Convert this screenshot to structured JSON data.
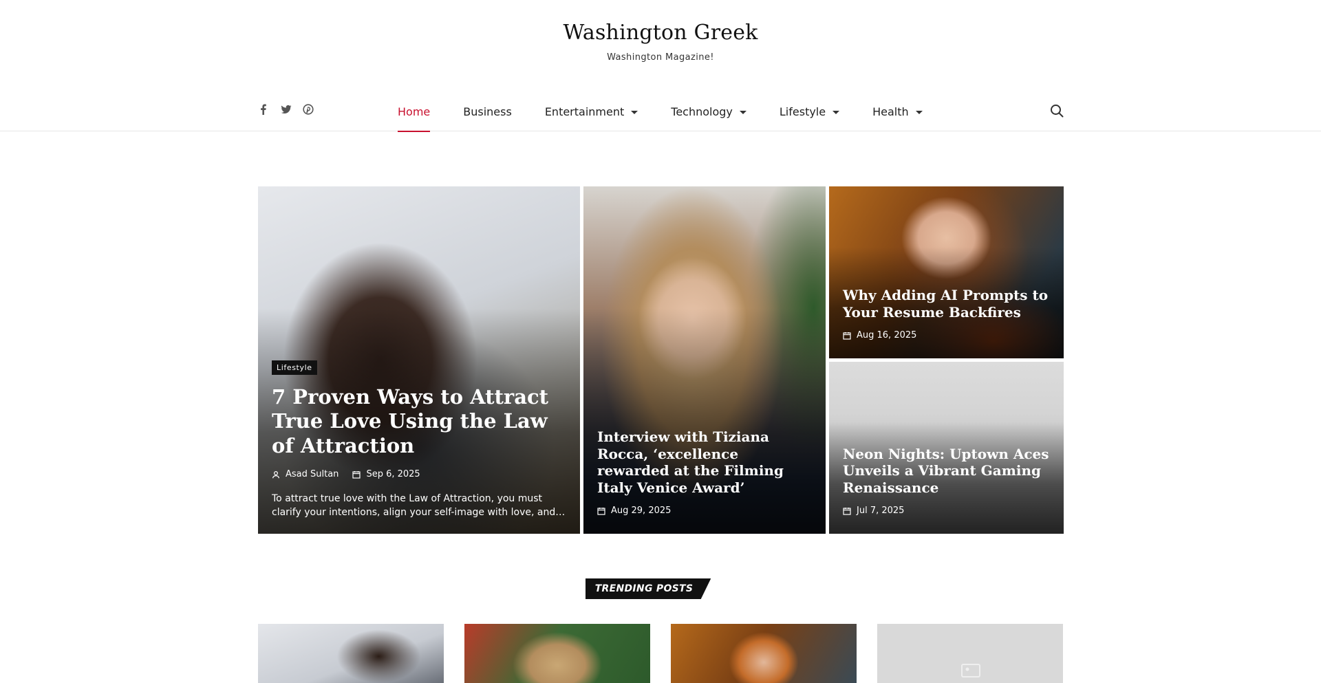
{
  "site": {
    "title": "Washington Greek",
    "tagline": "Washington Magazine!"
  },
  "social": [
    {
      "icon": "facebook-icon"
    },
    {
      "icon": "twitter-icon"
    },
    {
      "icon": "pinterest-icon"
    }
  ],
  "nav": {
    "items": [
      {
        "label": "Home",
        "active": true,
        "dropdown": false
      },
      {
        "label": "Business",
        "active": false,
        "dropdown": false
      },
      {
        "label": "Entertainment",
        "active": false,
        "dropdown": true
      },
      {
        "label": "Technology",
        "active": false,
        "dropdown": true
      },
      {
        "label": "Lifestyle",
        "active": false,
        "dropdown": true
      },
      {
        "label": "Health",
        "active": false,
        "dropdown": true
      }
    ],
    "search_icon": "search-icon"
  },
  "featured": {
    "main": {
      "category": "Lifestyle",
      "title": "7 Proven Ways to Attract True Love Using the Law of Attraction",
      "author": "Asad Sultan",
      "date": "Sep 6, 2025",
      "excerpt": "To attract true love with the Law of Attraction, you must clarify your intentions, align your self-image with love, and…"
    },
    "middle": {
      "title": "Interview with Tiziana Rocca, ‘excellence rewarded at the Filming Italy Venice Award’",
      "date": "Aug 29, 2025"
    },
    "top_right": {
      "title": "Why Adding AI Prompts to Your Resume Backfires",
      "date": "Aug 16, 2025"
    },
    "bottom_right": {
      "title": "Neon Nights: Uptown Aces Unveils a Vibrant Gaming Renaissance",
      "date": "Jul 7, 2025"
    }
  },
  "trending": {
    "label": "TRENDING POSTS"
  },
  "colors": {
    "accent": "#c8102e",
    "text": "#222222",
    "badge_bg": "#111111"
  }
}
